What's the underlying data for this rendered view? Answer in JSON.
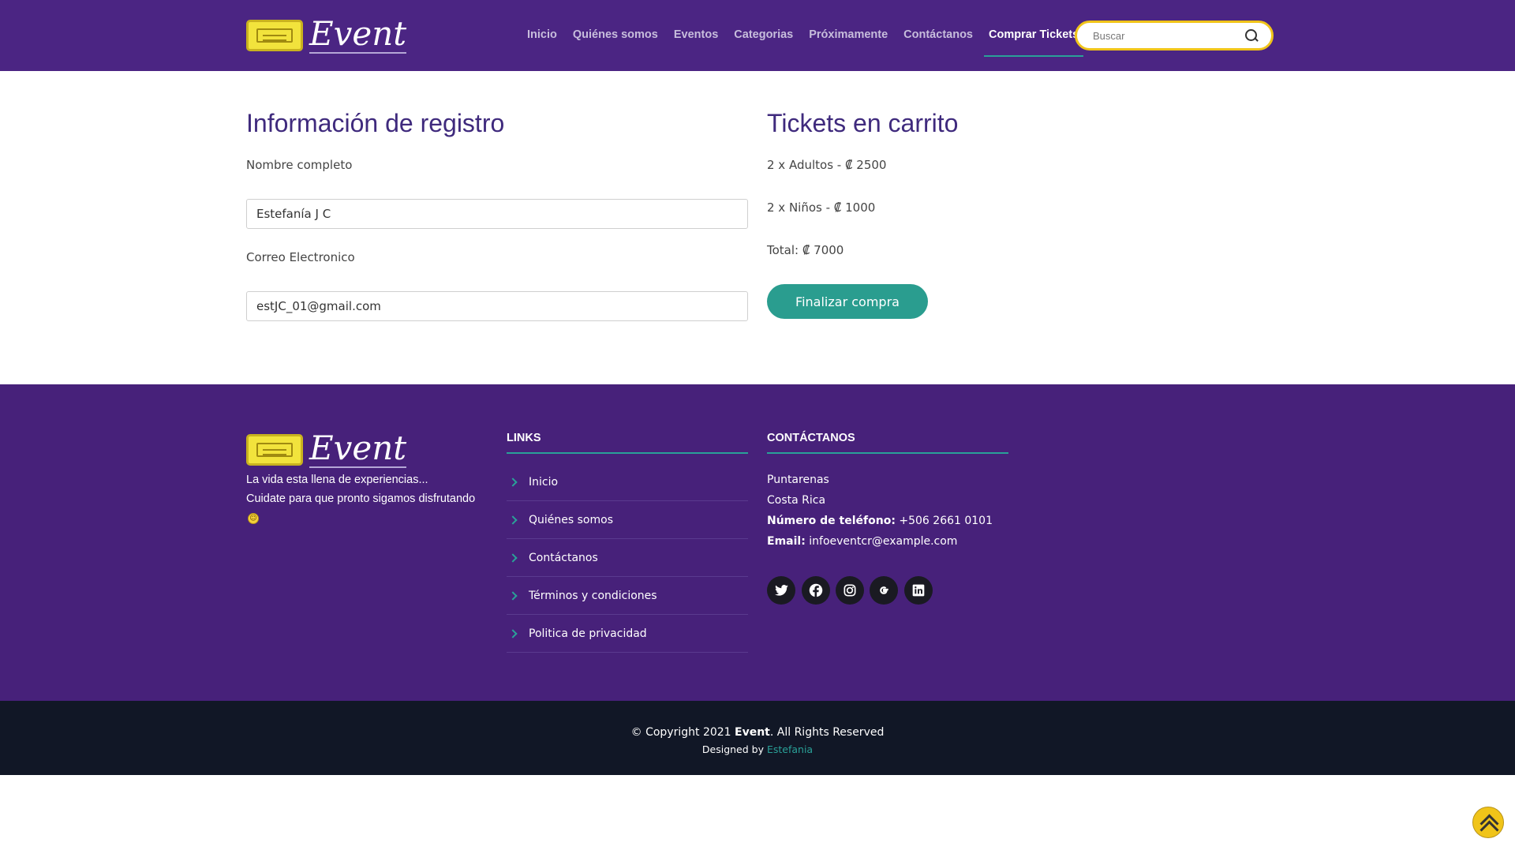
{
  "header": {
    "logo_text": "Event",
    "nav": [
      {
        "label": "Inicio"
      },
      {
        "label": "Quiénes somos"
      },
      {
        "label": "Eventos"
      },
      {
        "label": "Categorias"
      },
      {
        "label": "Próximamente"
      },
      {
        "label": "Contáctanos"
      },
      {
        "label": "Comprar Tickets",
        "active": true
      }
    ],
    "search": {
      "placeholder": "Buscar",
      "value": "",
      "icon": "search-icon"
    }
  },
  "registration": {
    "title": "Información de registro",
    "name_label": "Nombre completo",
    "name_value": "Estefanía J C",
    "email_label": "Correo Electronico",
    "email_value": "estJC_01@gmail.com"
  },
  "cart": {
    "title": "Tickets en carrito",
    "lines": [
      "2 x Adultos - ₡ 2500",
      "2 x Niños - ₡ 1000"
    ],
    "total": "Total: ₡ 7000",
    "button_label": "Finalizar compra"
  },
  "footer": {
    "logo_text": "Event",
    "tagline_1": "La vida esta llena de experiencias...",
    "tagline_2": "Cuidate para que pronto sigamos disfrutando",
    "links_title": "LINKS",
    "links": [
      "Inicio",
      "Quiénes somos",
      "Contáctanos",
      "Términos y condiciones",
      "Politica de privacidad"
    ],
    "contact_title": "CONTÁCTANOS",
    "city": "Puntarenas",
    "country": "Costa Rica",
    "phone_label": "Número de teléfono:",
    "phone_value": "+506 2661 0101",
    "email_label": "Email:",
    "email_value": "infoeventcr@example.com",
    "social_icons": [
      "twitter-icon",
      "facebook-icon",
      "instagram-icon",
      "google-icon",
      "linkedin-icon"
    ]
  },
  "bottom": {
    "copyright_prefix": "© Copyright 2021",
    "copyright_brand": "Event",
    "copyright_suffix": ". All Rights Reserved",
    "designed_prefix": "Designed by",
    "designed_author": "Estefania"
  },
  "colors": {
    "header_bg": "#4b2583",
    "footer_bg": "#47217a",
    "accent": "#2a9d8f",
    "search_border": "#f0c419",
    "bottom_bar": "#111726"
  }
}
